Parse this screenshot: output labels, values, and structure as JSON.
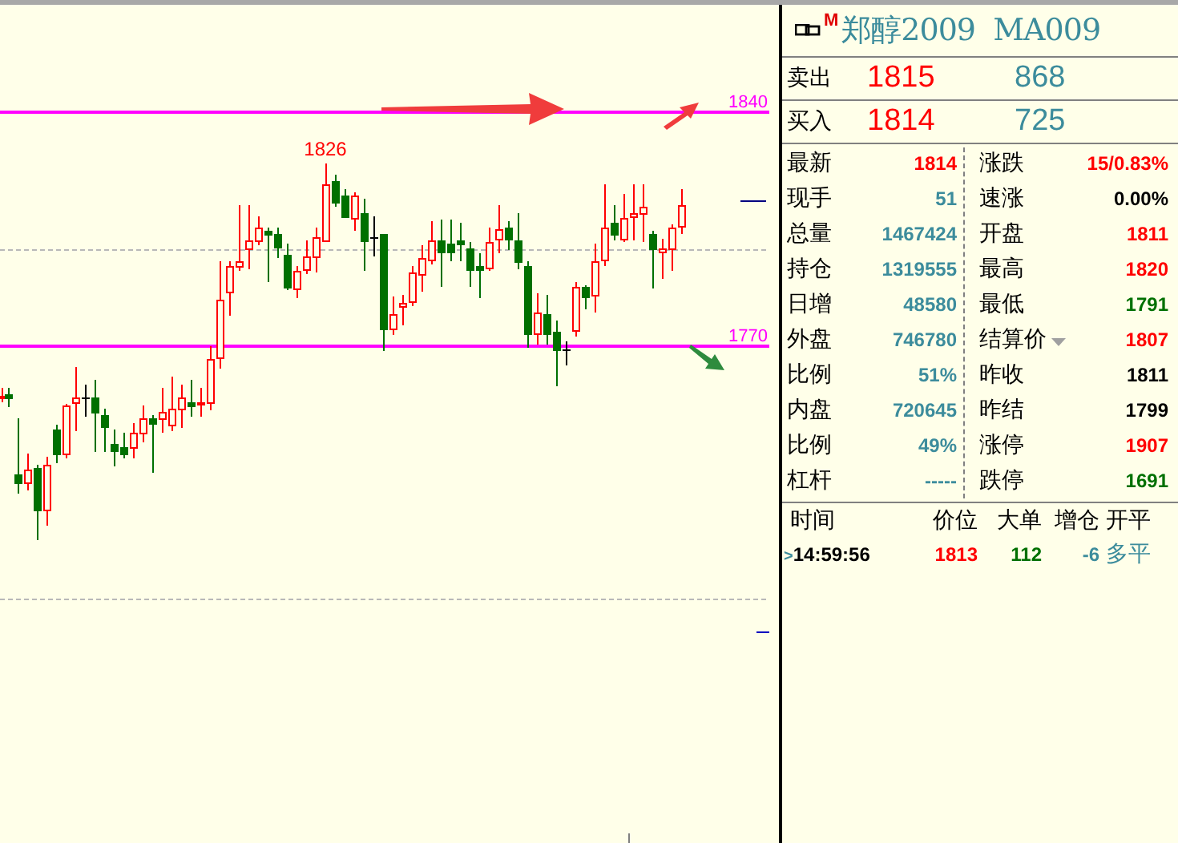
{
  "chart": {
    "high_label": "1826",
    "price_lines": [
      {
        "label": "1840"
      },
      {
        "label": "1770"
      }
    ]
  },
  "quote": {
    "badge": "M",
    "title": "郑醇2009  MA009",
    "book": [
      {
        "label": "卖出",
        "price": "1815",
        "volume": "868"
      },
      {
        "label": "买入",
        "price": "1814",
        "volume": "725"
      }
    ],
    "stats": [
      {
        "left": {
          "label": "最新",
          "value": "1814",
          "color": "#ff0000"
        },
        "right": {
          "label": "涨跌",
          "value": "15/0.83%",
          "color": "#ff0000",
          "dropdown": false
        }
      },
      {
        "left": {
          "label": "现手",
          "value": "51",
          "color": "#3c8c9c"
        },
        "right": {
          "label": "速涨",
          "value": "0.00%",
          "color": "#000000",
          "dropdown": false
        }
      },
      {
        "left": {
          "label": "总量",
          "value": "1467424",
          "color": "#3c8c9c"
        },
        "right": {
          "label": "开盘",
          "value": "1811",
          "color": "#ff0000",
          "dropdown": false
        }
      },
      {
        "left": {
          "label": "持仓",
          "value": "1319555",
          "color": "#3c8c9c"
        },
        "right": {
          "label": "最高",
          "value": "1820",
          "color": "#ff0000",
          "dropdown": false
        }
      },
      {
        "left": {
          "label": "日增",
          "value": "48580",
          "color": "#3c8c9c"
        },
        "right": {
          "label": "最低",
          "value": "1791",
          "color": "#007000",
          "dropdown": false
        }
      },
      {
        "left": {
          "label": "外盘",
          "value": "746780",
          "color": "#3c8c9c"
        },
        "right": {
          "label": "结算价",
          "value": "1807",
          "color": "#ff0000",
          "dropdown": true
        }
      },
      {
        "left": {
          "label": "比例",
          "value": "51%",
          "color": "#3c8c9c"
        },
        "right": {
          "label": "昨收",
          "value": "1811",
          "color": "#000000",
          "dropdown": false
        }
      },
      {
        "left": {
          "label": "内盘",
          "value": "720645",
          "color": "#3c8c9c"
        },
        "right": {
          "label": "昨结",
          "value": "1799",
          "color": "#000000",
          "dropdown": false
        }
      },
      {
        "left": {
          "label": "比例",
          "value": "49%",
          "color": "#3c8c9c"
        },
        "right": {
          "label": "涨停",
          "value": "1907",
          "color": "#ff0000",
          "dropdown": false
        }
      },
      {
        "left": {
          "label": "杠杆",
          "value": "-----",
          "color": "#3c8c9c"
        },
        "right": {
          "label": "跌停",
          "value": "1691",
          "color": "#007000",
          "dropdown": false
        }
      }
    ],
    "ticks": {
      "columns": [
        "时间",
        "价位",
        "大单",
        "增仓",
        "开平"
      ],
      "rows": [
        {
          "cells": [
            {
              "marker": ">",
              "value": "14:59:56",
              "color": "#000000"
            },
            {
              "value": "1813",
              "color": "#ff0000"
            },
            {
              "value": "112",
              "color": "#007000"
            },
            {
              "value": "-6",
              "color": "#3c8c9c"
            },
            {
              "value": "多平",
              "color": "#3c8c9c"
            }
          ]
        }
      ]
    }
  }
}
